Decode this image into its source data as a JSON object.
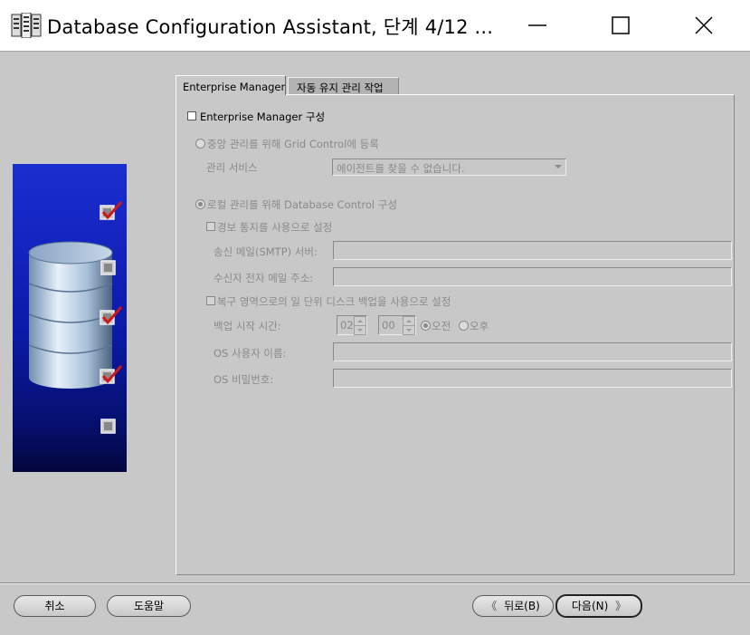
{
  "window": {
    "title": "Database Configuration Assistant, 단계 4/12 ...",
    "minimize_glyph": "—",
    "maximize_glyph": "☐",
    "close_glyph": "✕"
  },
  "tabs": [
    {
      "label": "Enterprise Manager",
      "active": true
    },
    {
      "label": "자동 유지 관리 작업",
      "active": false
    }
  ],
  "em_config": {
    "checkbox_label": "Enterprise Manager 구성",
    "checked": false,
    "grid_control_radio_label": "중앙 관리를 위해 Grid Control에 등록",
    "management_service_label": "관리 서비스",
    "management_service_value": "에이전트를 찾을 수 없습니다.",
    "db_control_radio_label": "로컬 관리를 위해 Database Control 구성",
    "alert_checkbox_label": "경보 통지를 사용으로 설정",
    "smtp_label": "송신 메일(SMTP) 서버:",
    "smtp_value": "",
    "email_label": "수신자 전자 메일 주소:",
    "email_value": "",
    "backup_checkbox_label": "복구 영역으로의 일 단위 디스크 백업을 사용으로 설정",
    "backup_time_label": "백업 시작 시간:",
    "backup_hour": "02",
    "backup_minute": "00",
    "am_label": "오전",
    "pm_label": "오후",
    "os_user_label": "OS 사용자 이름:",
    "os_user_value": "",
    "os_password_label": "OS 비밀번호:",
    "os_password_value": ""
  },
  "buttons": {
    "cancel": "취소",
    "help": "도움말",
    "back": "뒤로(B)",
    "next": "다음(N)",
    "back_chevron": "《",
    "next_chevron": "》"
  },
  "colors": {
    "panel_bg": "#c8c8c8",
    "side_image_top": "#1a2fcf",
    "side_image_bottom": "#03063d",
    "check_red": "#d01818"
  }
}
